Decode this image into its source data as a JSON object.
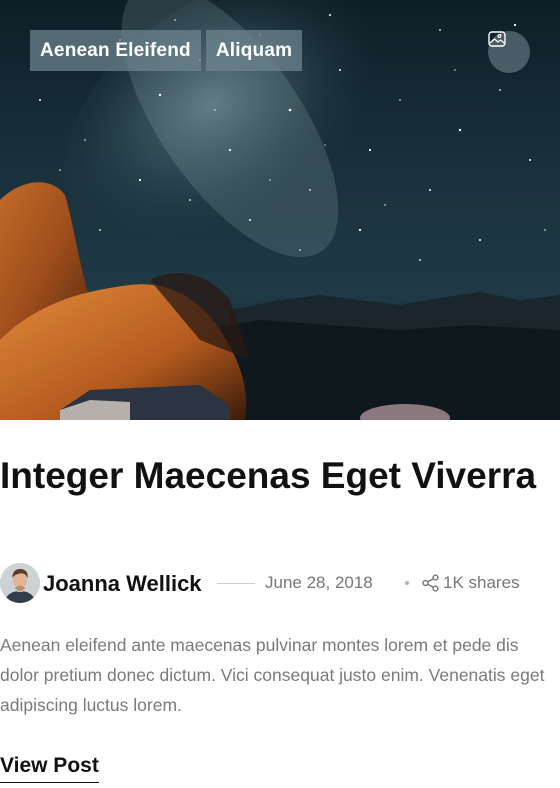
{
  "post": {
    "categories": [
      "Aenean Eleifend",
      "Aliquam"
    ],
    "format_icon": "image-icon",
    "title": "Integer Maecenas Eget Viverra",
    "author": {
      "name": "Joanna Wellick",
      "avatar_icon": "avatar"
    },
    "date": "June 28, 2018",
    "shares": {
      "icon": "share-icon",
      "label": "1K shares"
    },
    "excerpt": "Aenean eleifend ante maecenas pulvinar montes lorem et pede dis dolor pretium donec dictum. Vici consequat justo enim. Venenatis eget adipiscing luctus lorem.",
    "cta_label": "View Post"
  },
  "colors": {
    "tag_background": "#6e8791",
    "text_primary": "#111111",
    "text_muted": "#7a7a7a"
  }
}
